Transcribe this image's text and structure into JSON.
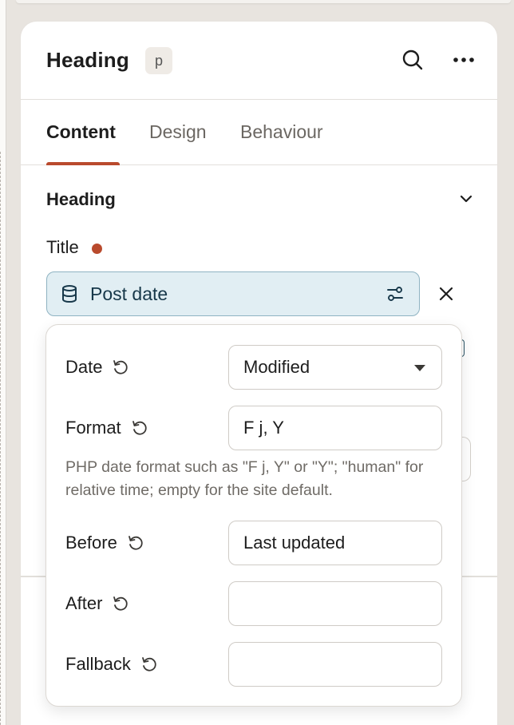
{
  "panel": {
    "title": "Heading",
    "tag": "p"
  },
  "tabs": [
    {
      "label": "Content",
      "active": true
    },
    {
      "label": "Design",
      "active": false
    },
    {
      "label": "Behaviour",
      "active": false
    }
  ],
  "section": {
    "title": "Heading"
  },
  "title_field": {
    "label": "Title",
    "dynamic_value": "Post date"
  },
  "popover": {
    "date": {
      "label": "Date",
      "value": "Modified"
    },
    "format": {
      "label": "Format",
      "value": "F j, Y",
      "help": "PHP date format such as \"F j, Y\" or \"Y\"; \"human\" for relative time; empty for the site default."
    },
    "before": {
      "label": "Before",
      "value": "Last updated"
    },
    "after": {
      "label": "After",
      "value": ""
    },
    "fallback": {
      "label": "Fallback",
      "value": ""
    }
  },
  "colors": {
    "accent": "#b94a2d",
    "dynamic_bg": "#e1eef3",
    "dynamic_border": "#8fb3c2"
  }
}
